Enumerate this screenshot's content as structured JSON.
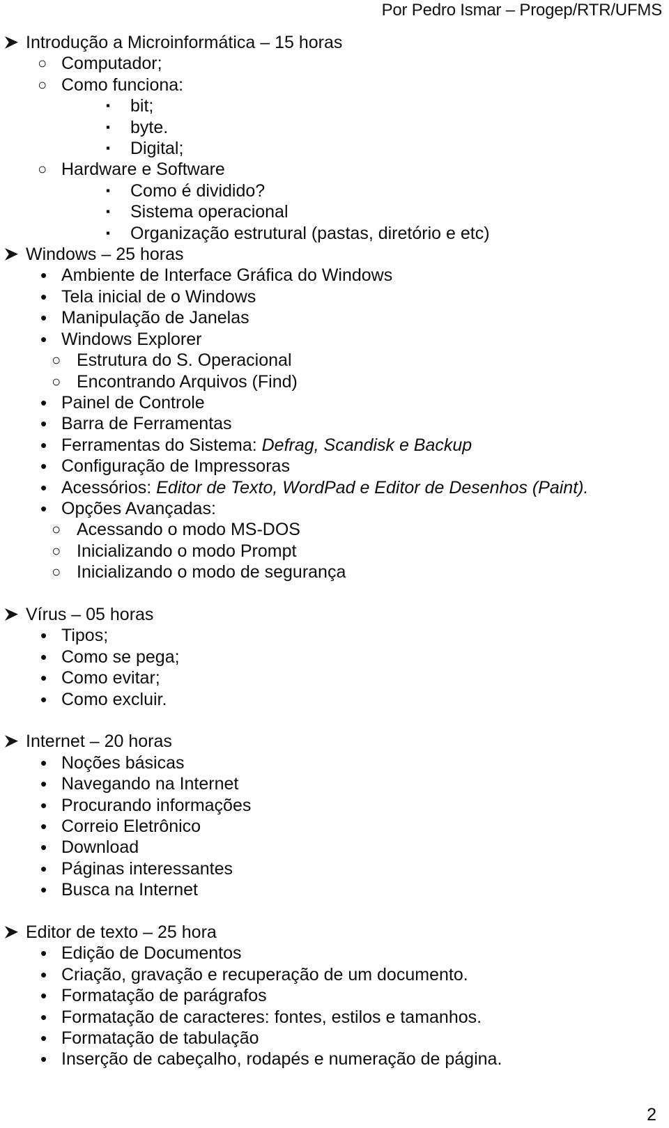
{
  "header": {
    "text": "Por Pedro Ismar – Progep/RTR/UFMS"
  },
  "footer": {
    "page_number": "2"
  },
  "bullets": {
    "arrow": "➢",
    "disc": "•",
    "circle": "○",
    "square": "▪"
  },
  "outline": {
    "sections": [
      {
        "title": "Introdução a Microinformática – 15 horas",
        "items": [
          {
            "text": "Computador;"
          },
          {
            "text": "Como funciona:"
          },
          {
            "text": "bit;"
          },
          {
            "text": "byte."
          },
          {
            "text": "Digital;"
          },
          {
            "text": "Hardware e Software"
          },
          {
            "text": "Como é dividido?"
          },
          {
            "text": "Sistema operacional"
          },
          {
            "text": "Organização estrutural (pastas, diretório e etc)"
          }
        ]
      },
      {
        "title": "Windows – 25 horas",
        "items": [
          {
            "text": "Ambiente de Interface Gráfica do Windows"
          },
          {
            "text": "Tela inicial de o Windows"
          },
          {
            "text": "Manipulação de Janelas"
          },
          {
            "text": "Windows Explorer"
          },
          {
            "text": "Estrutura do S. Operacional"
          },
          {
            "text": "Encontrando Arquivos (Find)"
          },
          {
            "text": "Painel de Controle"
          },
          {
            "text": "Barra de Ferramentas"
          },
          {
            "text": "Ferramentas do Sistema: ",
            "emphasis": "Defrag, Scandisk e Backup"
          },
          {
            "text": "Configuração de Impressoras"
          },
          {
            "text": "Acessórios: ",
            "emphasis": "Editor de Texto, WordPad e Editor de Desenhos (Paint)."
          },
          {
            "text": "Opções Avançadas:"
          },
          {
            "text": "Acessando o modo MS-DOS"
          },
          {
            "text": "Inicializando o modo Prompt"
          },
          {
            "text": "Inicializando o modo de segurança"
          }
        ]
      },
      {
        "title": "Vírus – 05 horas",
        "items": [
          {
            "text": "Tipos;"
          },
          {
            "text": "Como se pega;"
          },
          {
            "text": "Como evitar;"
          },
          {
            "text": "Como excluir."
          }
        ]
      },
      {
        "title": "Internet – 20 horas",
        "items": [
          {
            "text": "Noções básicas"
          },
          {
            "text": "Navegando na Internet"
          },
          {
            "text": "Procurando informações"
          },
          {
            "text": "Correio Eletrônico"
          },
          {
            "text": "Download"
          },
          {
            "text": "Páginas interessantes"
          },
          {
            "text": "Busca na Internet"
          }
        ]
      },
      {
        "title": "Editor de texto – 25 hora",
        "items": [
          {
            "text": "Edição de Documentos"
          },
          {
            "text": "Criação, gravação e recuperação de um documento."
          },
          {
            "text": "Formatação de parágrafos"
          },
          {
            "text": "Formatação de caracteres: fontes, estilos e tamanhos."
          },
          {
            "text": "Formatação de tabulação"
          },
          {
            "text": "Inserção de cabeçalho, rodapés e numeração de página."
          }
        ]
      }
    ]
  }
}
